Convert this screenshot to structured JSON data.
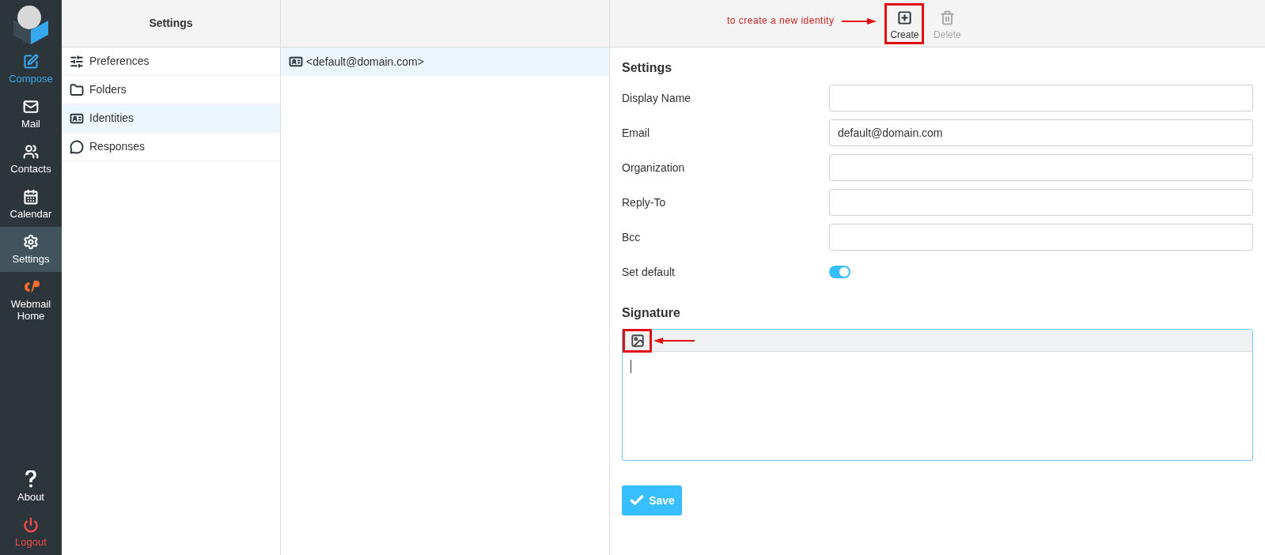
{
  "nav": {
    "top": [
      {
        "label": "Compose",
        "selected": false,
        "color": "#37a8f0"
      },
      {
        "label": "Mail",
        "selected": false,
        "color": "#ffffff"
      },
      {
        "label": "Contacts",
        "selected": false,
        "color": "#ffffff"
      },
      {
        "label": "Calendar",
        "selected": false,
        "color": "#ffffff"
      },
      {
        "label": "Settings",
        "selected": true,
        "color": "#ffffff"
      },
      {
        "label": "Webmail Home",
        "selected": false,
        "color": "#ffffff"
      }
    ],
    "bottom": [
      {
        "label": "About",
        "selected": false,
        "color": "#ffffff"
      },
      {
        "label": "Logout",
        "selected": false,
        "color": "#f04848"
      }
    ]
  },
  "settings_panel": {
    "title": "Settings",
    "items": [
      {
        "label": "Preferences",
        "selected": false
      },
      {
        "label": "Folders",
        "selected": false
      },
      {
        "label": "Identities",
        "selected": true
      },
      {
        "label": "Responses",
        "selected": false
      }
    ]
  },
  "identities": [
    {
      "label": "<default@domain.com>",
      "selected": true
    }
  ],
  "toolbar": {
    "annotation": "to create a new identity",
    "buttons": [
      {
        "label": "Create",
        "disabled": false,
        "highlighted": true
      },
      {
        "label": "Delete",
        "disabled": true,
        "highlighted": false
      }
    ]
  },
  "form": {
    "section": "Settings",
    "fields": [
      {
        "kind": "text",
        "label": "Display Name"
      },
      {
        "kind": "text",
        "label": "Email",
        "value": "default@domain.com"
      },
      {
        "kind": "text",
        "label": "Organization"
      },
      {
        "kind": "text",
        "label": "Reply-To"
      },
      {
        "kind": "text",
        "label": "Bcc"
      },
      {
        "kind": "toggle",
        "label": "Set default",
        "on": true
      }
    ],
    "signature_title": "Signature",
    "signature_image_highlighted": true,
    "save": "Save"
  }
}
